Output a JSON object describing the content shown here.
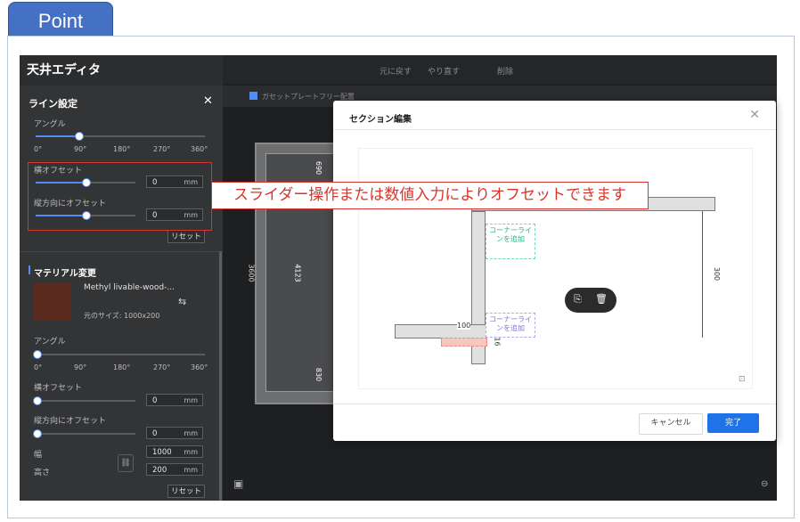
{
  "point_tab": "Point",
  "callout": "スライダー操作または数値入力によりオフセットできます",
  "app": {
    "title": "天井エディタ",
    "toolbar": {
      "undo": "元に戻す",
      "redo": "やり直す",
      "delete": "削除",
      "gasket": "ガセットプレートフリー配置"
    },
    "line_settings": {
      "title": "ライン設定",
      "angle_label": "アングル",
      "angle_ticks": [
        "0°",
        "90°",
        "180°",
        "270°",
        "360°"
      ],
      "angle_value": 0.25,
      "h_offset_label": "横オフセット",
      "h_offset_value": "0",
      "v_offset_label": "縦方向にオフセット",
      "v_offset_value": "0",
      "unit": "mm",
      "reset": "リセット"
    },
    "material": {
      "title": "マテリアル変更",
      "name": "Methyl livable-wood-...",
      "size": "元のサイズ: 1000x200",
      "angle_label": "アングル",
      "angle_ticks": [
        "0°",
        "90°",
        "180°",
        "270°",
        "360°"
      ],
      "h_offset_label": "横オフセット",
      "h_offset_value": "0",
      "v_offset_label": "縦方向にオフセット",
      "v_offset_value": "0",
      "width_label": "幅",
      "width_value": "1000",
      "height_label": "高さ",
      "height_value": "200",
      "unit": "mm",
      "reset": "リセット"
    },
    "canvas_dims": {
      "d1": "690",
      "d2": "4123",
      "d3": "830",
      "d4": "3600"
    }
  },
  "dialog": {
    "title": "セクション編集",
    "corner_top": "コーナーライ\nンを追加",
    "corner_bottom": "コーナーライ\nンを追加",
    "dim_100": "100",
    "dim_16": "16",
    "dim_300": "300",
    "cancel": "キャンセル",
    "ok": "完了"
  },
  "colors": {
    "accent": "#4f8cf7",
    "callout": "#d9342b",
    "point": "#4471c4",
    "ok": "#1e73e8"
  }
}
